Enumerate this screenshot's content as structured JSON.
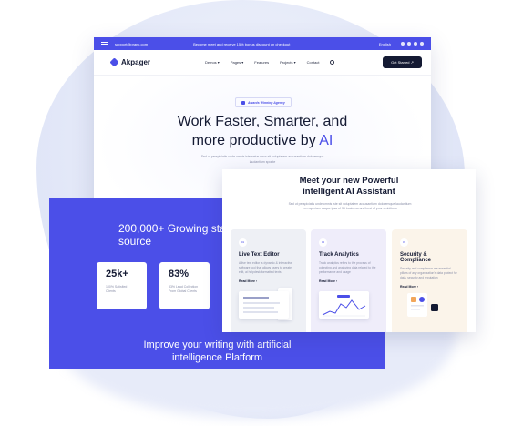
{
  "colors": {
    "accent": "#4b4fe8",
    "dark": "#141a33",
    "muted": "#8a8fa8"
  },
  "site": {
    "topbar": {
      "email": "support@prank.com",
      "promo": "Become meet and receive 15% bonus discount on checkout",
      "language": "English",
      "social_icons": [
        "facebook-icon",
        "twitter-icon",
        "linkedin-icon",
        "youtube-icon"
      ]
    },
    "brand": "Akpager",
    "menu": [
      "Demos ▾",
      "Pages ▾",
      "Features",
      "Projects ▾",
      "Contact"
    ],
    "cta": "Get Started ↗",
    "hero": {
      "badge": "Awards Winning Agency",
      "headline_line1": "Work Faster, Smarter, and",
      "headline_line2_pre": "more productive by ",
      "headline_line2_accent": "AI",
      "subtext": "Sed ut perspiciatis unde omnis iste natus error sit voluptatem accusantium doloremque laudantium sponte"
    }
  },
  "stats": {
    "title": "200,000+ Growing startups trust as their single source",
    "cards": [
      {
        "value": "25k+",
        "label": "100% Satisfied Clients"
      },
      {
        "value": "83%",
        "label": "83% Lead Collection From Global Clients"
      }
    ],
    "footer_line1": "Improve your writing with artificial",
    "footer_line2": "intelligence Platform"
  },
  "assistant": {
    "title_line1": "Meet your new Powerful",
    "title_line2": "intelligent AI Assistant",
    "subtext": "Sed ut perspiciatis unde omnis iste sit voluptatem accusantium doloremque laudantium rem aperiam eaque ipsa of 35 business and best of your ambitions",
    "features": [
      {
        "num": "01",
        "title": "Live Text Editor",
        "desc": "A live text editor is dynamic & interactive software tool that allows users to create edit, ai helpdesk formatted texts",
        "more": "Read More ›",
        "bg": "#eef0f5"
      },
      {
        "num": "02",
        "title": "Track Analytics",
        "desc": "Track analytics refers to the process of collecting and analyzing data related to the performance and usage",
        "more": "Read More ›",
        "bg": "#efedfa"
      },
      {
        "num": "03",
        "title": "Security & Compliance",
        "desc": "Security and compliance are essential pillars of any organization's data protect for data, security and reputation",
        "more": "Read More ›",
        "bg": "#fbf4ea"
      }
    ]
  }
}
